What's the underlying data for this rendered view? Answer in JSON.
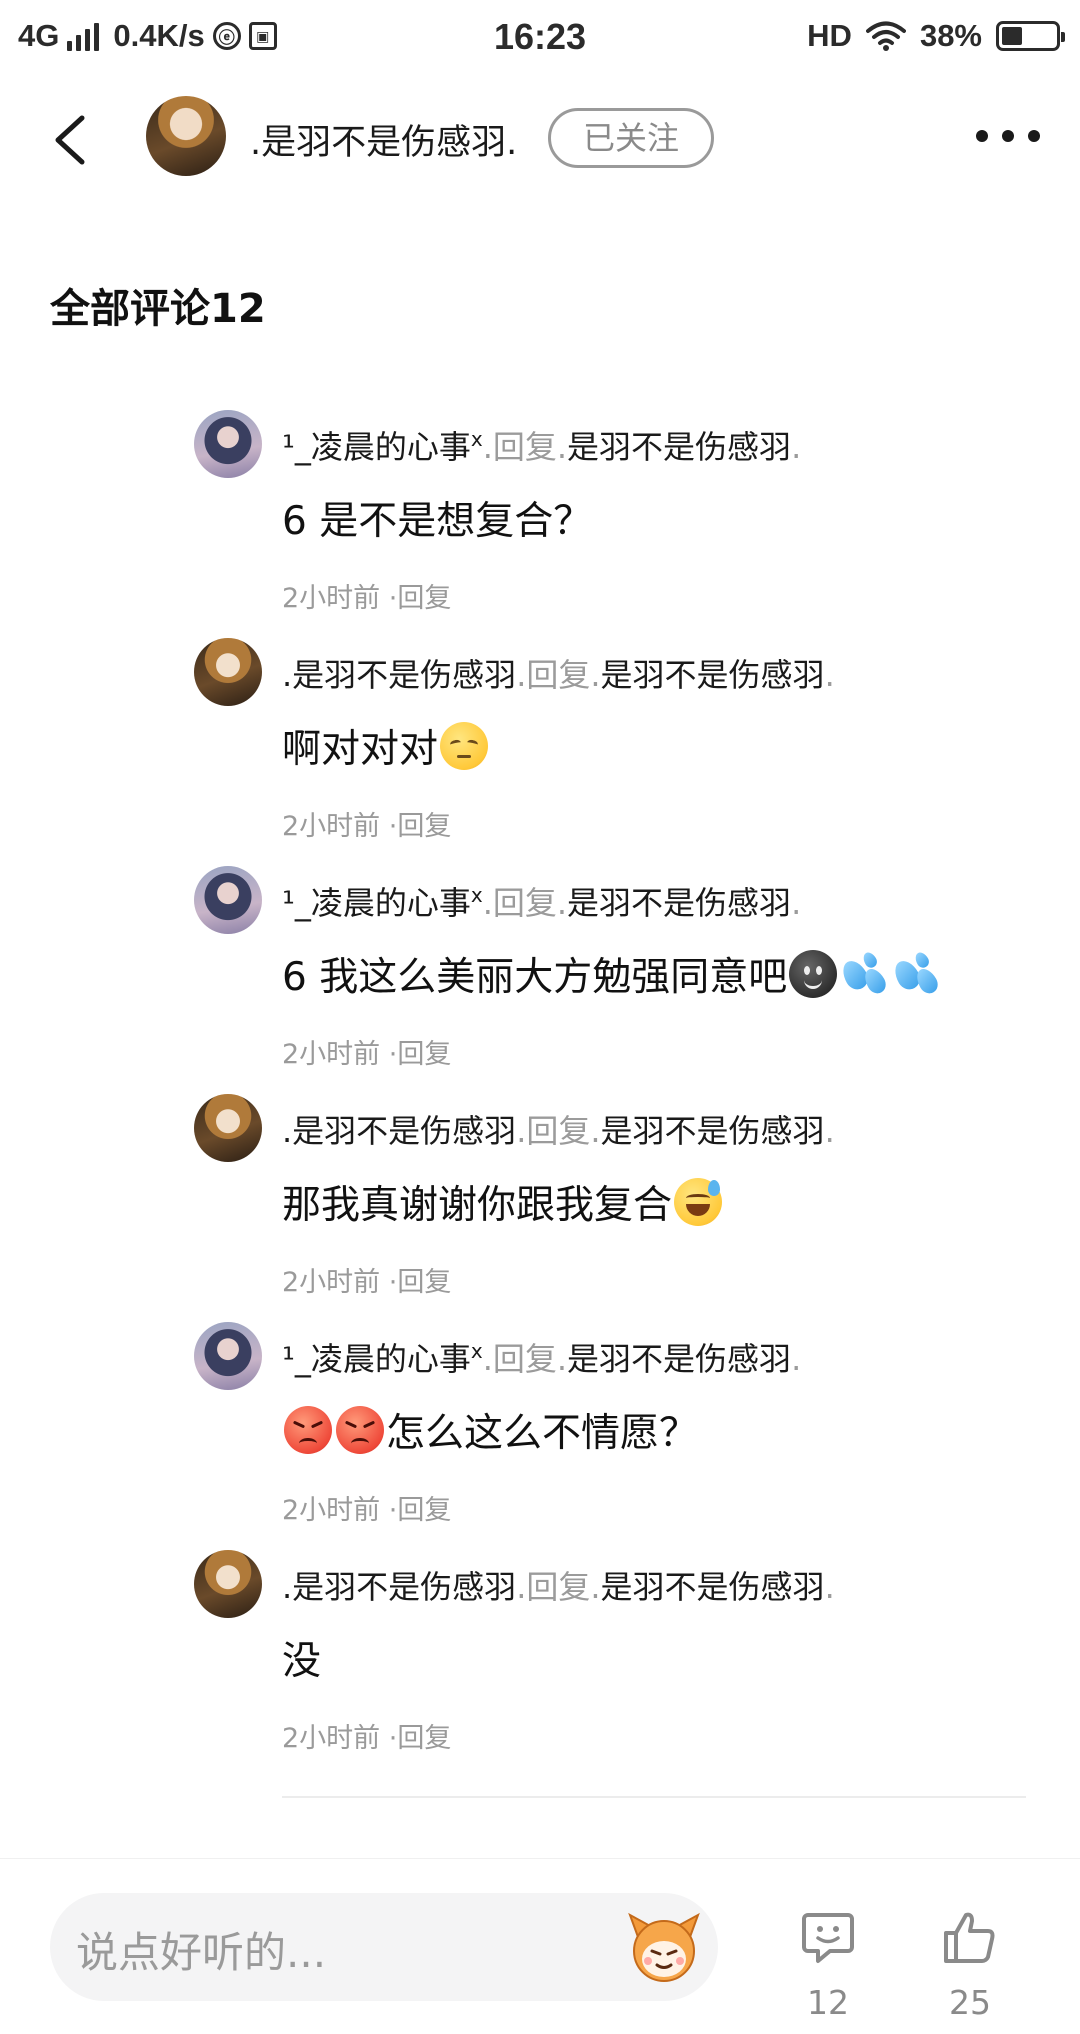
{
  "status_bar": {
    "network": "4G",
    "speed": "0.4K/s",
    "icon1_glyph": "ⓔ",
    "icon2_glyph": "▣",
    "time": "16:23",
    "hd": "HD",
    "battery_percent": "38%",
    "battery_level": 0.38
  },
  "header": {
    "username": ".是羽不是伤感羽.",
    "follow_label": "已关注"
  },
  "section_title": "全部评论12",
  "comments": [
    {
      "author": "¹_凌晨的心事",
      "author_sup": "x",
      "reply_word": ".回复.",
      "reply_to": "是羽不是伤感羽",
      "end_dot": ".",
      "text": "6 是不是想复合？",
      "time": "2小时前",
      "reply_label": "·回复"
    },
    {
      "author": ".是羽不是伤感羽",
      "author_sup": "",
      "reply_word": ".回复.",
      "reply_to": "是羽不是伤感羽",
      "end_dot": ".",
      "text": "啊对对对",
      "time": "2小时前",
      "reply_label": "·回复"
    },
    {
      "author": "¹_凌晨的心事",
      "author_sup": "x",
      "reply_word": ".回复.",
      "reply_to": "是羽不是伤感羽",
      "end_dot": ".",
      "text": "6 我这么美丽大方勉强同意吧",
      "time": "2小时前",
      "reply_label": "·回复"
    },
    {
      "author": ".是羽不是伤感羽",
      "author_sup": "",
      "reply_word": ".回复.",
      "reply_to": "是羽不是伤感羽",
      "end_dot": ".",
      "text": "那我真谢谢你跟我复合",
      "time": "2小时前",
      "reply_label": "·回复"
    },
    {
      "author": "¹_凌晨的心事",
      "author_sup": "x",
      "reply_word": ".回复.",
      "reply_to": "是羽不是伤感羽",
      "end_dot": ".",
      "text": "怎么这么不情愿？",
      "time": "2小时前",
      "reply_label": "·回复"
    },
    {
      "author": ".是羽不是伤感羽",
      "author_sup": "",
      "reply_word": ".回复.",
      "reply_to": "是羽不是伤感羽",
      "end_dot": ".",
      "text": "没",
      "time": "2小时前",
      "reply_label": "·回复"
    }
  ],
  "bottom_bar": {
    "input_placeholder": "说点好听的...",
    "comment_count": "12",
    "like_count": "25"
  },
  "icons": {
    "back": "chevron-left-icon",
    "more": "more-dots-icon",
    "comment": "comment-bubble-icon",
    "like": "thumbs-up-icon",
    "mascot": "mascot-emoji-icon"
  }
}
